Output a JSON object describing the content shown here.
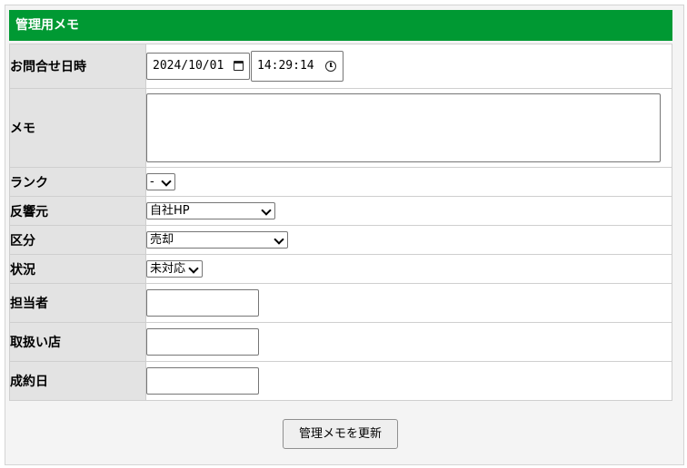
{
  "header": {
    "title": "管理用メモ"
  },
  "fields": {
    "datetime": {
      "label": "お問合せ日時",
      "date_value": "2024/10/01",
      "time_value": "14:29:14"
    },
    "memo": {
      "label": "メモ",
      "value": ""
    },
    "rank": {
      "label": "ランク",
      "selected": "-"
    },
    "source": {
      "label": "反響元",
      "selected": "自社HP"
    },
    "category": {
      "label": "区分",
      "selected": "売却"
    },
    "status": {
      "label": "状況",
      "selected": "未対応"
    },
    "staff": {
      "label": "担当者",
      "value": ""
    },
    "branch": {
      "label": "取扱い店",
      "value": ""
    },
    "contract_date": {
      "label": "成約日",
      "value": ""
    }
  },
  "actions": {
    "update_label": "管理メモを更新"
  },
  "colors": {
    "header_bg": "#009933",
    "label_bg": "#e3e3e3",
    "panel_bg": "#f4f4f4"
  }
}
